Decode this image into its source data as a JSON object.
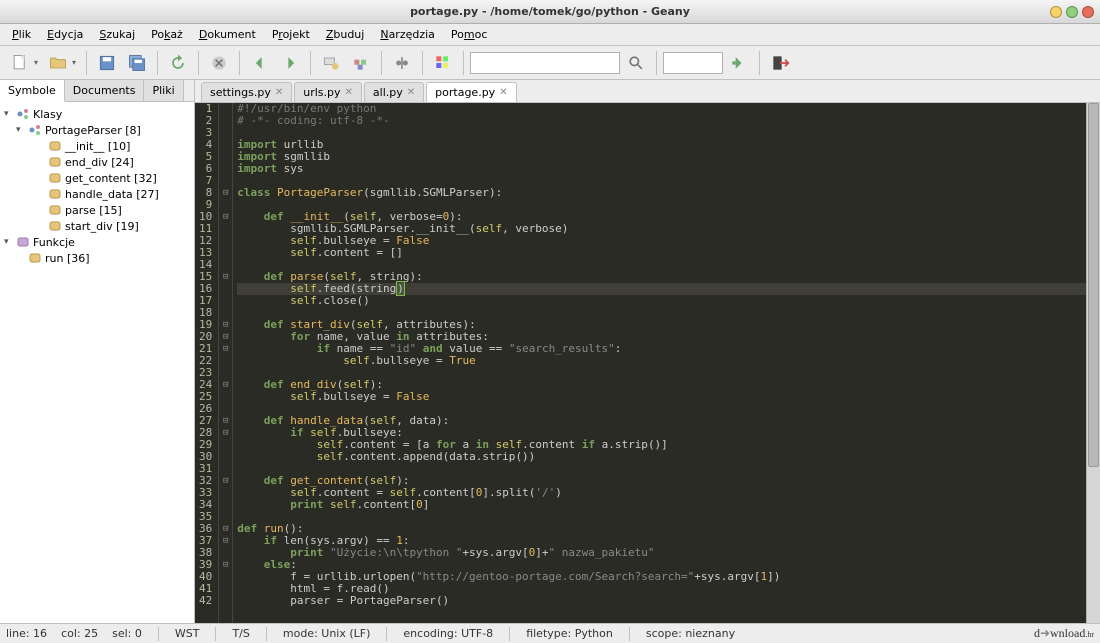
{
  "window": {
    "title": "portage.py - /home/tomek/go/python - Geany"
  },
  "menu": [
    "Plik",
    "Edycja",
    "Szukaj",
    "Pokaż",
    "Dokument",
    "Projekt",
    "Zbuduj",
    "Narzędzia",
    "Pomoc"
  ],
  "menu_underline": [
    0,
    0,
    0,
    2,
    0,
    1,
    0,
    0,
    2
  ],
  "sidebar": {
    "tabs": [
      "Symbole",
      "Documents",
      "Pliki"
    ],
    "active_tab": 0,
    "tree": [
      {
        "depth": 0,
        "expand": "▾",
        "icon": "class",
        "label": "Klasy"
      },
      {
        "depth": 1,
        "expand": "▾",
        "icon": "class",
        "label": "PortageParser [8]"
      },
      {
        "depth": 2,
        "expand": "",
        "icon": "method",
        "label": "__init__ [10]"
      },
      {
        "depth": 2,
        "expand": "",
        "icon": "method",
        "label": "end_div [24]"
      },
      {
        "depth": 2,
        "expand": "",
        "icon": "method",
        "label": "get_content [32]"
      },
      {
        "depth": 2,
        "expand": "",
        "icon": "method",
        "label": "handle_data [27]"
      },
      {
        "depth": 2,
        "expand": "",
        "icon": "method",
        "label": "parse [15]"
      },
      {
        "depth": 2,
        "expand": "",
        "icon": "method",
        "label": "start_div [19]"
      },
      {
        "depth": 0,
        "expand": "▾",
        "icon": "func",
        "label": "Funkcje"
      },
      {
        "depth": 1,
        "expand": "",
        "icon": "method",
        "label": "run [36]"
      }
    ]
  },
  "file_tabs": [
    {
      "name": "settings.py",
      "active": false
    },
    {
      "name": "urls.py",
      "active": false
    },
    {
      "name": "all.py",
      "active": false
    },
    {
      "name": "portage.py",
      "active": true
    }
  ],
  "code": {
    "start_line": 1,
    "current_line": 16,
    "lines": [
      {
        "n": 1,
        "fold": "",
        "html": "<span class='comment'>#!/usr/bin/env python</span>"
      },
      {
        "n": 2,
        "fold": "",
        "html": "<span class='comment'># -*- coding: utf-8 -*-</span>"
      },
      {
        "n": 3,
        "fold": "",
        "html": ""
      },
      {
        "n": 4,
        "fold": "",
        "html": "<span class='kw'>import</span> urllib"
      },
      {
        "n": 5,
        "fold": "",
        "html": "<span class='kw'>import</span> sgmllib"
      },
      {
        "n": 6,
        "fold": "",
        "html": "<span class='kw'>import</span> sys"
      },
      {
        "n": 7,
        "fold": "",
        "html": ""
      },
      {
        "n": 8,
        "fold": "⊟",
        "html": "<span class='kw'>class</span> <span class='name'>PortageParser</span><span class='paren'>(</span>sgmllib.SGMLParser<span class='paren'>)</span>:"
      },
      {
        "n": 9,
        "fold": "",
        "html": ""
      },
      {
        "n": 10,
        "fold": "⊟",
        "html": "    <span class='kw'>def</span> <span class='fn'>__init__</span><span class='paren'>(</span><span class='self'>self</span>, verbose=<span class='num'>0</span><span class='paren'>)</span>:"
      },
      {
        "n": 11,
        "fold": "",
        "html": "        sgmllib.SGMLParser.__init__<span class='paren'>(</span><span class='self'>self</span>, verbose<span class='paren'>)</span>"
      },
      {
        "n": 12,
        "fold": "",
        "html": "        <span class='self'>self</span>.bullseye = <span class='const'>False</span>"
      },
      {
        "n": 13,
        "fold": "",
        "html": "        <span class='self'>self</span>.content = <span class='paren'>[]</span>"
      },
      {
        "n": 14,
        "fold": "",
        "html": ""
      },
      {
        "n": 15,
        "fold": "⊟",
        "html": "    <span class='kw'>def</span> <span class='fn'>parse</span><span class='paren'>(</span><span class='self'>self</span>, string<span class='paren'>)</span>:"
      },
      {
        "n": 16,
        "fold": "",
        "html": "        <span class='self'>self</span>.feed<span class='paren'>(</span>string<span class='cursor-box'>)</span>"
      },
      {
        "n": 17,
        "fold": "",
        "html": "        <span class='self'>self</span>.close<span class='paren'>()</span>"
      },
      {
        "n": 18,
        "fold": "",
        "html": ""
      },
      {
        "n": 19,
        "fold": "⊟",
        "html": "    <span class='kw'>def</span> <span class='fn'>start_div</span><span class='paren'>(</span><span class='self'>self</span>, attributes<span class='paren'>)</span>:"
      },
      {
        "n": 20,
        "fold": "⊟",
        "html": "        <span class='kw'>for</span> name, value <span class='kw'>in</span> attributes:"
      },
      {
        "n": 21,
        "fold": "⊟",
        "html": "            <span class='kw'>if</span> name == <span class='str'>\"id\"</span> <span class='kw'>and</span> value == <span class='str'>\"search_results\"</span>:"
      },
      {
        "n": 22,
        "fold": "",
        "html": "                <span class='self'>self</span>.bullseye = <span class='const'>True</span>"
      },
      {
        "n": 23,
        "fold": "",
        "html": ""
      },
      {
        "n": 24,
        "fold": "⊟",
        "html": "    <span class='kw'>def</span> <span class='fn'>end_div</span><span class='paren'>(</span><span class='self'>self</span><span class='paren'>)</span>:"
      },
      {
        "n": 25,
        "fold": "",
        "html": "        <span class='self'>self</span>.bullseye = <span class='const'>False</span>"
      },
      {
        "n": 26,
        "fold": "",
        "html": ""
      },
      {
        "n": 27,
        "fold": "⊟",
        "html": "    <span class='kw'>def</span> <span class='fn'>handle_data</span><span class='paren'>(</span><span class='self'>self</span>, data<span class='paren'>)</span>:"
      },
      {
        "n": 28,
        "fold": "⊟",
        "html": "        <span class='kw'>if</span> <span class='self'>self</span>.bullseye:"
      },
      {
        "n": 29,
        "fold": "",
        "html": "            <span class='self'>self</span>.content = <span class='paren'>[</span>a <span class='kw'>for</span> a <span class='kw'>in</span> <span class='self'>self</span>.content <span class='kw'>if</span> a.strip<span class='paren'>()]</span>"
      },
      {
        "n": 30,
        "fold": "",
        "html": "            <span class='self'>self</span>.content.append<span class='paren'>(</span>data.strip<span class='paren'>())</span>"
      },
      {
        "n": 31,
        "fold": "",
        "html": ""
      },
      {
        "n": 32,
        "fold": "⊟",
        "html": "    <span class='kw'>def</span> <span class='fn'>get_content</span><span class='paren'>(</span><span class='self'>self</span><span class='paren'>)</span>:"
      },
      {
        "n": 33,
        "fold": "",
        "html": "        <span class='self'>self</span>.content = <span class='self'>self</span>.content<span class='paren'>[</span><span class='num'>0</span><span class='paren'>]</span>.split<span class='paren'>(</span><span class='str'>'/'</span><span class='paren'>)</span>"
      },
      {
        "n": 34,
        "fold": "",
        "html": "        <span class='kw'>print</span> <span class='self'>self</span>.content<span class='paren'>[</span><span class='num'>0</span><span class='paren'>]</span>"
      },
      {
        "n": 35,
        "fold": "",
        "html": ""
      },
      {
        "n": 36,
        "fold": "⊟",
        "html": "<span class='kw'>def</span> <span class='fn'>run</span><span class='paren'>()</span>:"
      },
      {
        "n": 37,
        "fold": "⊟",
        "html": "    <span class='kw'>if</span> len<span class='paren'>(</span>sys.argv<span class='paren'>)</span> == <span class='num'>1</span>:"
      },
      {
        "n": 38,
        "fold": "",
        "html": "        <span class='kw'>print</span> <span class='str'>\"Użycie:\\n\\tpython \"</span>+sys.argv<span class='paren'>[</span><span class='num'>0</span><span class='paren'>]</span>+<span class='str'>\" nazwa_pakietu\"</span>"
      },
      {
        "n": 39,
        "fold": "⊟",
        "html": "    <span class='kw'>else</span>:"
      },
      {
        "n": 40,
        "fold": "",
        "html": "        f = urllib.urlopen<span class='paren'>(</span><span class='str'>\"http://gentoo-portage.com/Search?search=\"</span>+sys.argv<span class='paren'>[</span><span class='num'>1</span><span class='paren'>])</span>"
      },
      {
        "n": 41,
        "fold": "",
        "html": "        html = f.read<span class='paren'>()</span>"
      },
      {
        "n": 42,
        "fold": "",
        "html": "        parser = PortageParser<span class='paren'>()</span>"
      }
    ]
  },
  "status": {
    "line": "line: 16",
    "col": "col: 25",
    "sel": "sel: 0",
    "insert": "WST",
    "tabs": "T/S",
    "mode": "mode: Unix (LF)",
    "encoding": "encoding: UTF-8",
    "filetype": "filetype: Python",
    "scope": "scope: nieznany"
  },
  "footer_logo": "download.hr"
}
